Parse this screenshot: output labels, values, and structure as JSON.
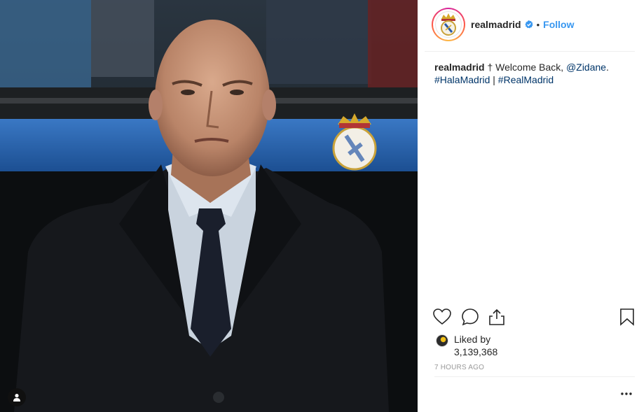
{
  "post": {
    "username": "realmadrid",
    "verified": true,
    "follow_label": "Follow",
    "separator": "•",
    "caption": {
      "author": "realmadrid",
      "emoji": "†",
      "text_before": "Welcome Back,",
      "mention": "@Zidane",
      "text_after": ".",
      "hashtag_1": "#HalaMadrid",
      "divider": "|",
      "hashtag_2": "#RealMadrid"
    },
    "liked_by_label": "Liked by",
    "likes_count": "3,139,368",
    "timestamp": "7 HOURS AGO"
  },
  "colors": {
    "follow_blue": "#3897f0",
    "link_blue": "#003569",
    "verified_blue": "#3897f0",
    "muted": "#999999"
  },
  "icons": [
    "user-tag-icon",
    "heart-icon",
    "comment-icon",
    "share-icon",
    "bookmark-icon",
    "more-options-icon",
    "verified-badge-icon"
  ]
}
